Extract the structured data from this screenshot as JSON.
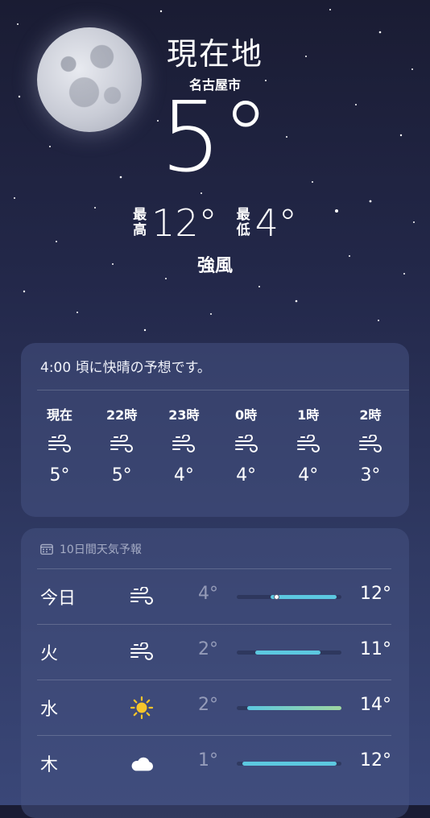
{
  "location": {
    "title": "現在地",
    "city": "名古屋市"
  },
  "current": {
    "temp": "5°",
    "high_label_1": "最",
    "high_label_2": "高",
    "high": "12°",
    "low_label_1": "最",
    "low_label_2": "低",
    "low": "4°",
    "condition": "強風"
  },
  "hourly": {
    "summary": "4:00 頃に快晴の予想です。",
    "items": [
      {
        "label": "現在",
        "icon": "wind-icon",
        "temp": "5°"
      },
      {
        "label": "22時",
        "icon": "wind-icon",
        "temp": "5°"
      },
      {
        "label": "23時",
        "icon": "wind-icon",
        "temp": "4°"
      },
      {
        "label": "0時",
        "icon": "wind-icon",
        "temp": "4°"
      },
      {
        "label": "1時",
        "icon": "wind-icon",
        "temp": "4°"
      },
      {
        "label": "2時",
        "icon": "wind-icon",
        "temp": "3°"
      }
    ]
  },
  "daily": {
    "header": "10日間天気予報",
    "header_icon": "calendar-icon",
    "days": [
      {
        "label": "今日",
        "icon": "wind-icon",
        "low": "4°",
        "high": "12°",
        "range_start": 0.32,
        "range_end": 0.95,
        "current_pos": 0.38,
        "bar_color": "#5cc8e0"
      },
      {
        "label": "火",
        "icon": "wind-icon",
        "low": "2°",
        "high": "11°",
        "range_start": 0.18,
        "range_end": 0.8,
        "bar_color": "#5cc8e0"
      },
      {
        "label": "水",
        "icon": "sun-icon",
        "low": "2°",
        "high": "14°",
        "range_start": 0.1,
        "range_end": 1.0,
        "bar_color": "#6fc9dc"
      },
      {
        "label": "木",
        "icon": "cloud-icon",
        "low": "1°",
        "high": "12°",
        "range_start": 0.05,
        "range_end": 0.95,
        "bar_color": "#5cc8e0"
      }
    ]
  },
  "colors": {
    "sun": "#f7c52a",
    "bar": "#5cc8e0",
    "bar_warm": "#9fd6a0"
  }
}
